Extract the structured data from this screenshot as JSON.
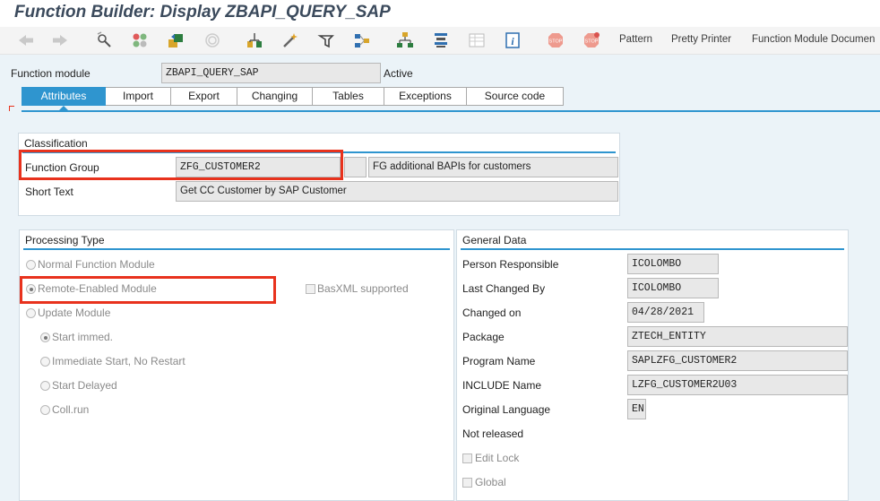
{
  "window": {
    "title": "Function Builder: Display ZBAPI_QUERY_SAP"
  },
  "toolbar": {
    "icons": [
      "back-arrow-icon",
      "forward-arrow-icon",
      "display-change-icon",
      "active-inactive-icon",
      "other-object-icon",
      "check-icon",
      "activate-icon",
      "where-used-icon",
      "test-icon",
      "hierarchy-icon",
      "stack-icon",
      "layout-icon",
      "info-icon",
      "breakpoint-icon",
      "external-breakpoint-icon"
    ],
    "pattern": "Pattern",
    "pretty_printer": "Pretty Printer",
    "function_module_doc": "Function Module Documen"
  },
  "header": {
    "function_module_label": "Function module",
    "function_module_value": "ZBAPI_QUERY_SAP",
    "status": "Active"
  },
  "tabs": [
    "Attributes",
    "Import",
    "Export",
    "Changing",
    "Tables",
    "Exceptions",
    "Source code"
  ],
  "active_tab": "Attributes",
  "classification": {
    "title": "Classification",
    "function_group_label": "Function Group",
    "function_group_value": "ZFG_CUSTOMER2",
    "function_group_desc": "FG additional BAPIs for customers",
    "short_text_label": "Short Text",
    "short_text_value": "Get CC Customer by SAP Customer"
  },
  "processing_type": {
    "title": "Processing Type",
    "normal": "Normal Function Module",
    "remote": "Remote-Enabled Module",
    "basxml": "BasXML supported",
    "update": "Update Module",
    "start_immed": "Start immed.",
    "immediate_no_restart": "Immediate Start, No Restart",
    "start_delayed": "Start Delayed",
    "coll_run": "Coll.run"
  },
  "general_data": {
    "title": "General Data",
    "person_responsible_label": "Person Responsible",
    "person_responsible": "ICOLOMBO",
    "last_changed_by_label": "Last Changed By",
    "last_changed_by": "ICOLOMBO",
    "changed_on_label": "Changed on",
    "changed_on": "04/28/2021",
    "package_label": "Package",
    "package": "ZTECH_ENTITY",
    "program_name_label": "Program Name",
    "program_name": "SAPLZFG_CUSTOMER2",
    "include_name_label": "INCLUDE Name",
    "include_name": "LZFG_CUSTOMER2U03",
    "original_language_label": "Original Language",
    "original_language": "EN",
    "not_released": "Not released",
    "edit_lock": "Edit Lock",
    "global": "Global"
  },
  "colors": {
    "accent": "#2f95cf",
    "highlight": "#e8321d",
    "panel_bg": "#ebf3f8"
  }
}
